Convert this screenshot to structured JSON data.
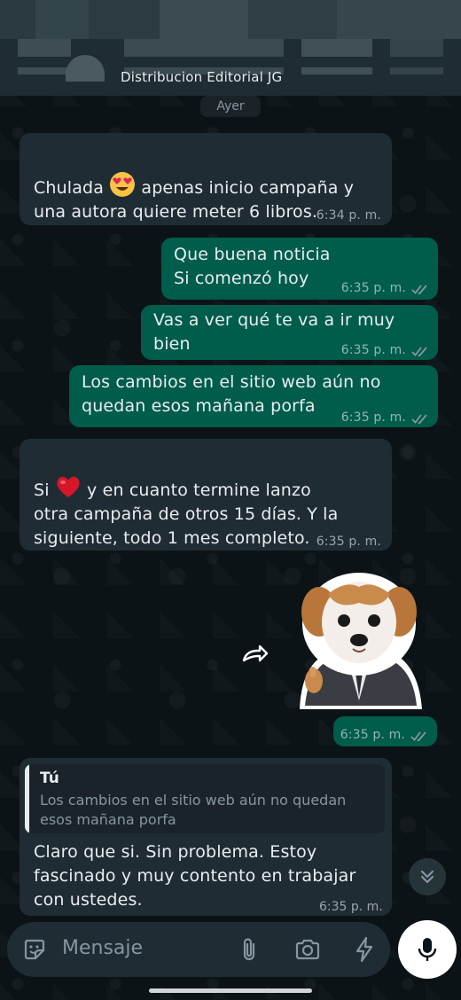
{
  "header": {
    "contact_name": "Distribucion Editorial JG"
  },
  "date_separator": "Ayer",
  "messages": [
    {
      "direction": "incoming",
      "text_before_emoji": "Chulada ",
      "emoji": "smiling-face-heart-eyes",
      "text_after_emoji": " apenas inicio campaña y\nuna autora quiere meter 6 libros.",
      "time": "6:34 p. m."
    },
    {
      "direction": "outgoing",
      "text": "Que buena noticia\nSi comenzó hoy",
      "time": "6:35 p. m.",
      "status": "read"
    },
    {
      "direction": "outgoing",
      "text": "Vas a ver qué te va a ir muy bien",
      "time": "6:35 p. m.",
      "status": "read"
    },
    {
      "direction": "outgoing",
      "text": "Los cambios en el sitio web aún no\nquedan esos mañana porfa",
      "time": "6:35 p. m.",
      "status": "read"
    },
    {
      "direction": "incoming",
      "text_before_emoji": "Si ",
      "emoji": "red-heart",
      "text_after_emoji": " y en cuanto termine lanzo\notra campaña de otros 15 días. Y la\nsiguiente, todo 1 mes completo.",
      "time": "6:35 p. m."
    },
    {
      "direction": "outgoing",
      "type": "sticker",
      "sticker": "puppy-in-suit-thumbs-up",
      "time": "6:35 p. m.",
      "status": "read"
    },
    {
      "direction": "incoming",
      "quote": {
        "author": "Tú",
        "text": "Los cambios en el sitio web aún no quedan\nesos mañana porfa"
      },
      "text": "Claro que si. Sin problema. Estoy\nfascinado y muy contento en trabajar\ncon ustedes.",
      "time": "6:35 p. m."
    }
  ],
  "composer": {
    "placeholder": "Mensaje",
    "icons": [
      "sticker-icon",
      "attach-icon",
      "camera-icon",
      "lightning-icon",
      "mic-icon"
    ]
  },
  "colors": {
    "incoming_bubble": "#1f2c34",
    "outgoing_bubble": "#005c4b",
    "read_ticks": "#8696a0",
    "background": "#0b141a"
  }
}
